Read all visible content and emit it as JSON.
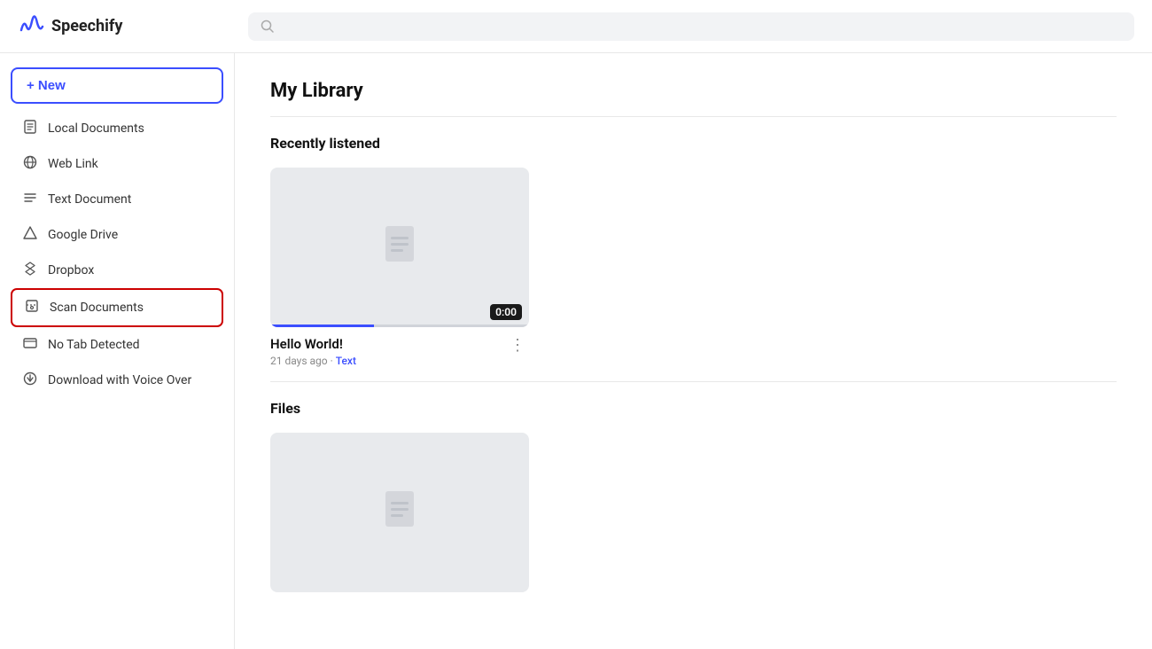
{
  "header": {
    "logo_text": "Speechify",
    "search_placeholder": ""
  },
  "sidebar": {
    "new_button_label": "+ New",
    "items": [
      {
        "id": "local-documents",
        "label": "Local Documents",
        "icon": "📄"
      },
      {
        "id": "web-link",
        "label": "Web Link",
        "icon": "☁"
      },
      {
        "id": "text-document",
        "label": "Text Document",
        "icon": "≡"
      },
      {
        "id": "google-drive",
        "label": "Google Drive",
        "icon": "△"
      },
      {
        "id": "dropbox",
        "label": "Dropbox",
        "icon": "❖"
      },
      {
        "id": "scan-documents",
        "label": "Scan Documents",
        "icon": "⊡",
        "highlighted": true
      },
      {
        "id": "no-tab-detected",
        "label": "No Tab Detected",
        "icon": "🖥"
      },
      {
        "id": "download-voice-over",
        "label": "Download with Voice Over",
        "icon": "⬇"
      }
    ]
  },
  "main": {
    "page_title": "My Library",
    "recently_listened_label": "Recently listened",
    "files_label": "Files",
    "recently_listened_items": [
      {
        "title": "Hello World!",
        "meta": "21 days ago",
        "meta_tag": "Text",
        "time_badge": "0:00",
        "progress": 40
      }
    ]
  },
  "icons": {
    "search": "🔍",
    "plus": "+",
    "document": "🗋",
    "more_vert": "⋮"
  }
}
